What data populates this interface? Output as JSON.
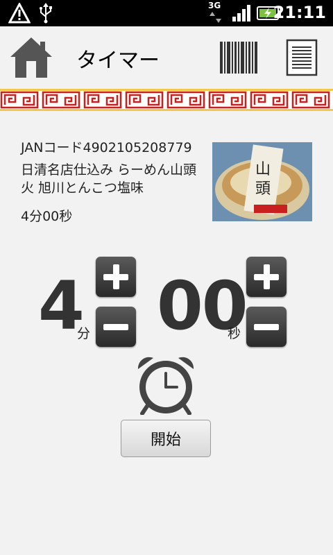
{
  "status_bar": {
    "time": "21:11",
    "network": "3G",
    "icons": [
      "warning-icon",
      "usb-icon",
      "signal-icon",
      "battery-charging-icon"
    ]
  },
  "header": {
    "title": "タイマー",
    "icons": [
      "home-icon",
      "barcode-icon",
      "list-icon"
    ]
  },
  "product": {
    "jan": "JANコード4902105208779",
    "name": "日清名店仕込み らーめん山頭火 旭川とんこつ塩味",
    "time": "4分00秒"
  },
  "timer": {
    "minutes": "4",
    "seconds": "00",
    "minutes_unit": "分",
    "seconds_unit": "秒"
  },
  "start_button": {
    "label": "開始"
  },
  "colors": {
    "ornament_red": "#c8201f",
    "ornament_gold": "#f0c94a",
    "button_dark": "#3a3a3a"
  }
}
